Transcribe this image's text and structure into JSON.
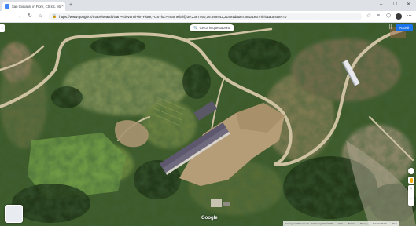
{
  "browser": {
    "tab_title": "San Giovanni in Fiore, CS loc. Ma...",
    "tab_close": "×",
    "new_tab": "+",
    "url": "https://www.google.it/maps/search/San+Giovanni+in+Fiore,+CS+loc+Imarnella/@39.2387460,16.699442,219m/data=!3m1!1e3?hl=it&authuser=0",
    "window_minimize": "–",
    "window_maximize": "☐",
    "window_close": "✕",
    "back": "←",
    "forward": "→",
    "reload": "↻",
    "home": "⌂"
  },
  "map": {
    "search_area_button": "Cerca in questa zona",
    "signin_button": "Accedi",
    "google_logo": "Google",
    "zoom_in": "+",
    "zoom_out": "−",
    "footer": [
      "Immagini ©2021 Google, Dati cartografici ©2021",
      "Italia",
      "Termini",
      "Privacy",
      "Invia feedback",
      "20 m"
    ]
  }
}
